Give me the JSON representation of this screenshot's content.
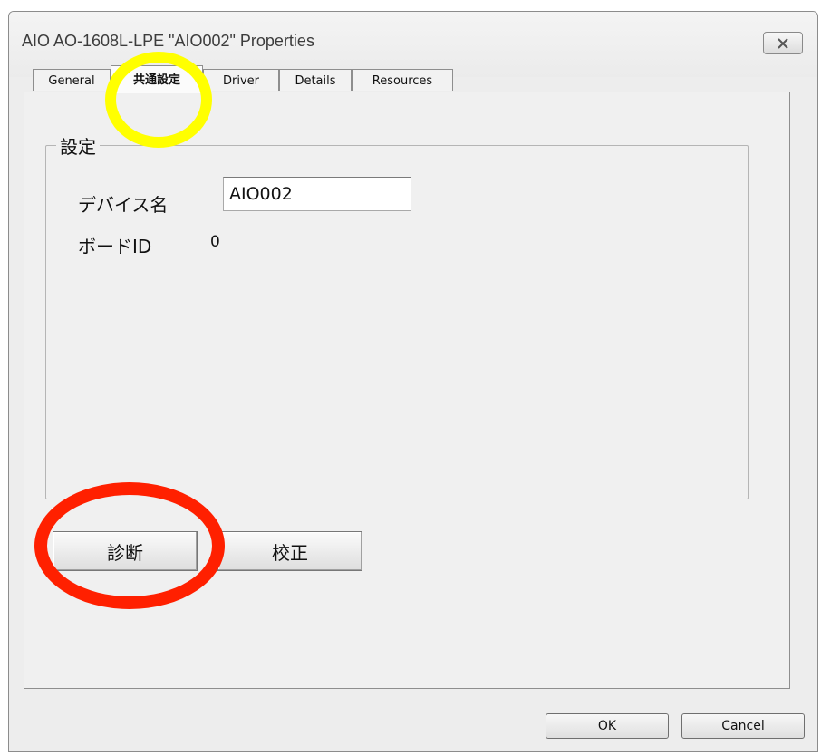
{
  "window": {
    "title": "AIO AO-1608L-LPE \"AIO002\" Properties",
    "close_label": "✕"
  },
  "tabs": [
    {
      "label": "General"
    },
    {
      "label": "共通設定",
      "active": true
    },
    {
      "label": "Driver"
    },
    {
      "label": "Details"
    },
    {
      "label": "Resources"
    }
  ],
  "settings": {
    "group_title": "設定",
    "device_name_label": "デバイス名",
    "device_name_value": "AIO002",
    "board_id_label": "ボードID",
    "board_id_value": "0"
  },
  "actions": {
    "diagnose_label": "診断",
    "calibrate_label": "校正"
  },
  "footer": {
    "ok_label": "OK",
    "cancel_label": "Cancel"
  },
  "highlights": {
    "tab_ring_color": "#ffff00",
    "button_ring_color": "#ff2000"
  }
}
